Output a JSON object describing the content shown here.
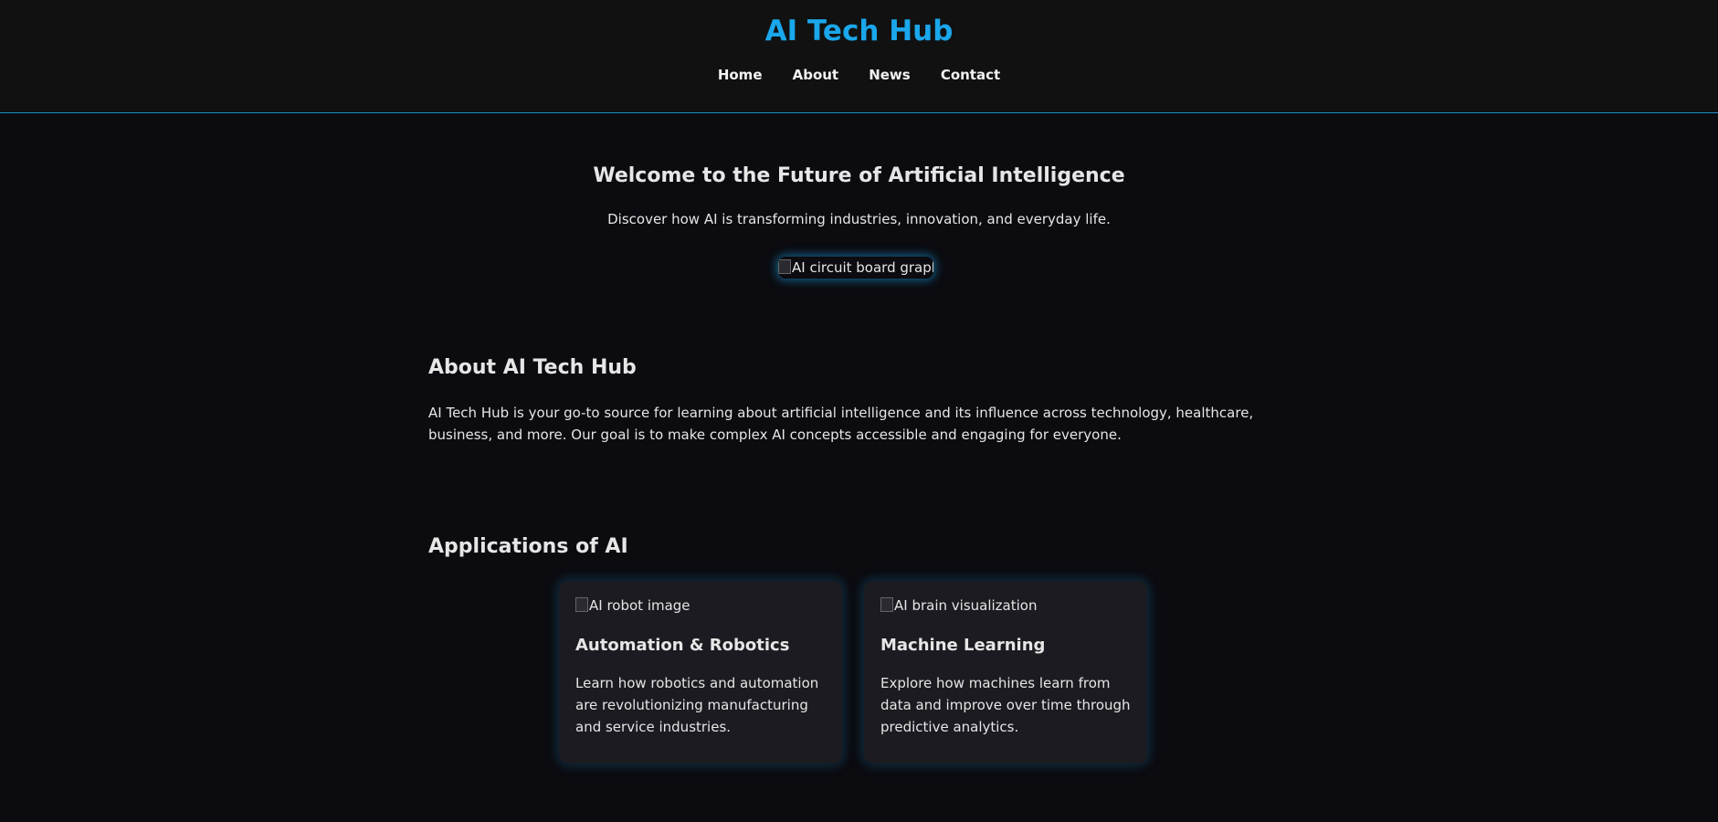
{
  "header": {
    "title": "AI Tech Hub",
    "nav": [
      "Home",
      "About",
      "News",
      "Contact"
    ]
  },
  "hero": {
    "title": "Welcome to the Future of Artificial Intelligence",
    "text": "Discover how AI is transforming industries, innovation, and everyday life.",
    "image_alt": "AI circuit board graphic"
  },
  "about": {
    "title": "About AI Tech Hub",
    "text": "AI Tech Hub is your go-to source for learning about artificial intelligence and its influence across technology, healthcare, business, and more. Our goal is to make complex AI concepts accessible and engaging for everyone."
  },
  "applications": {
    "title": "Applications of AI",
    "cards": [
      {
        "image_alt": "AI robot image",
        "title": "Automation & Robotics",
        "text": "Learn how robotics and automation are revolutionizing manufacturing and service industries."
      },
      {
        "image_alt": "AI brain visualization",
        "title": "Machine Learning",
        "text": "Explore how machines learn from data and improve over time through predictive analytics."
      }
    ]
  },
  "colors": {
    "accent": "#1aa7ec",
    "background": "#0b0b10",
    "header_bg": "#111111",
    "card_bg": "#1b1b21"
  }
}
